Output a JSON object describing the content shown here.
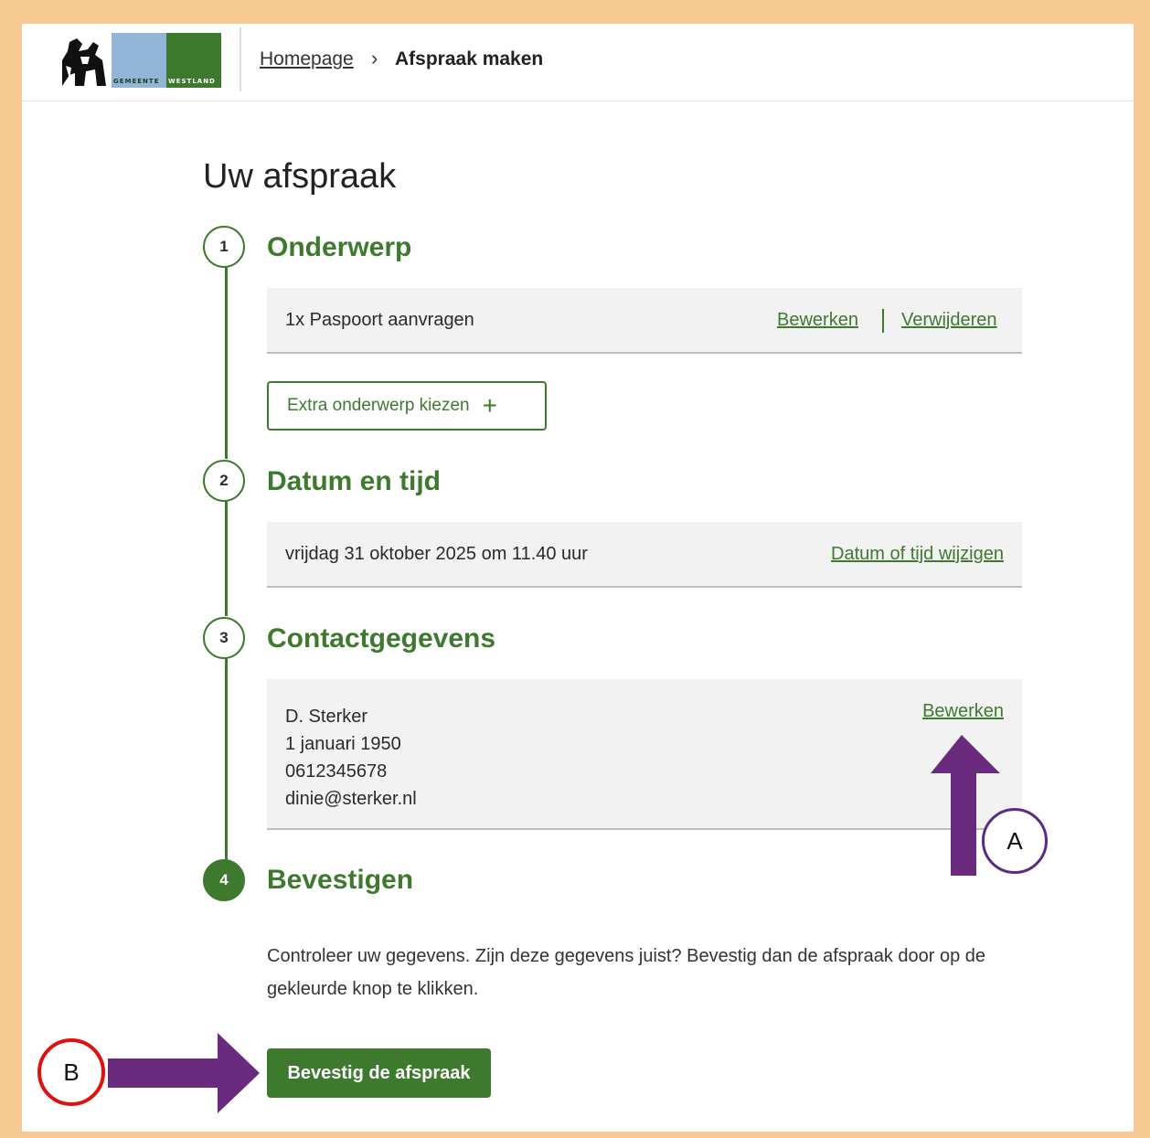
{
  "header": {
    "logo_words": [
      "GEMEENTE",
      "WESTLAND"
    ],
    "breadcrumb": {
      "home": "Homepage",
      "separator": "›",
      "current": "Afspraak maken"
    }
  },
  "page_title": "Uw afspraak",
  "steps": [
    {
      "number": "1",
      "title": "Onderwerp",
      "item": "1x Paspoort aanvragen",
      "edit_link": "Bewerken",
      "delete_link": "Verwijderen",
      "extra_button": "Extra onderwerp kiezen",
      "extra_icon": "plus-icon"
    },
    {
      "number": "2",
      "title": "Datum en tijd",
      "value": "vrijdag 31 oktober 2025 om 11.40 uur",
      "change_link": "Datum of tijd wijzigen"
    },
    {
      "number": "3",
      "title": "Contactgegevens",
      "lines": [
        "D. Sterker",
        "1 januari 1950",
        "0612345678",
        "dinie@sterker.nl"
      ],
      "edit_link": "Bewerken"
    },
    {
      "number": "4",
      "title": "Bevestigen",
      "text": "Controleer uw gegevens. Zijn deze gegevens juist? Bevestig dan de afspraak door op de gekleurde knop te klikken.",
      "button": "Bevestig de afspraak"
    }
  ],
  "annotations": [
    {
      "label": "A",
      "color": "#5b2a86",
      "arrow_color": "#6a2a7e",
      "direction": "up"
    },
    {
      "label": "B",
      "color": "#e01010",
      "arrow_color": "#6a2a7e",
      "direction": "right"
    }
  ],
  "colors": {
    "accent": "#3e7a2e",
    "frame": "#f6c992",
    "panel": "#f2f2f2"
  }
}
